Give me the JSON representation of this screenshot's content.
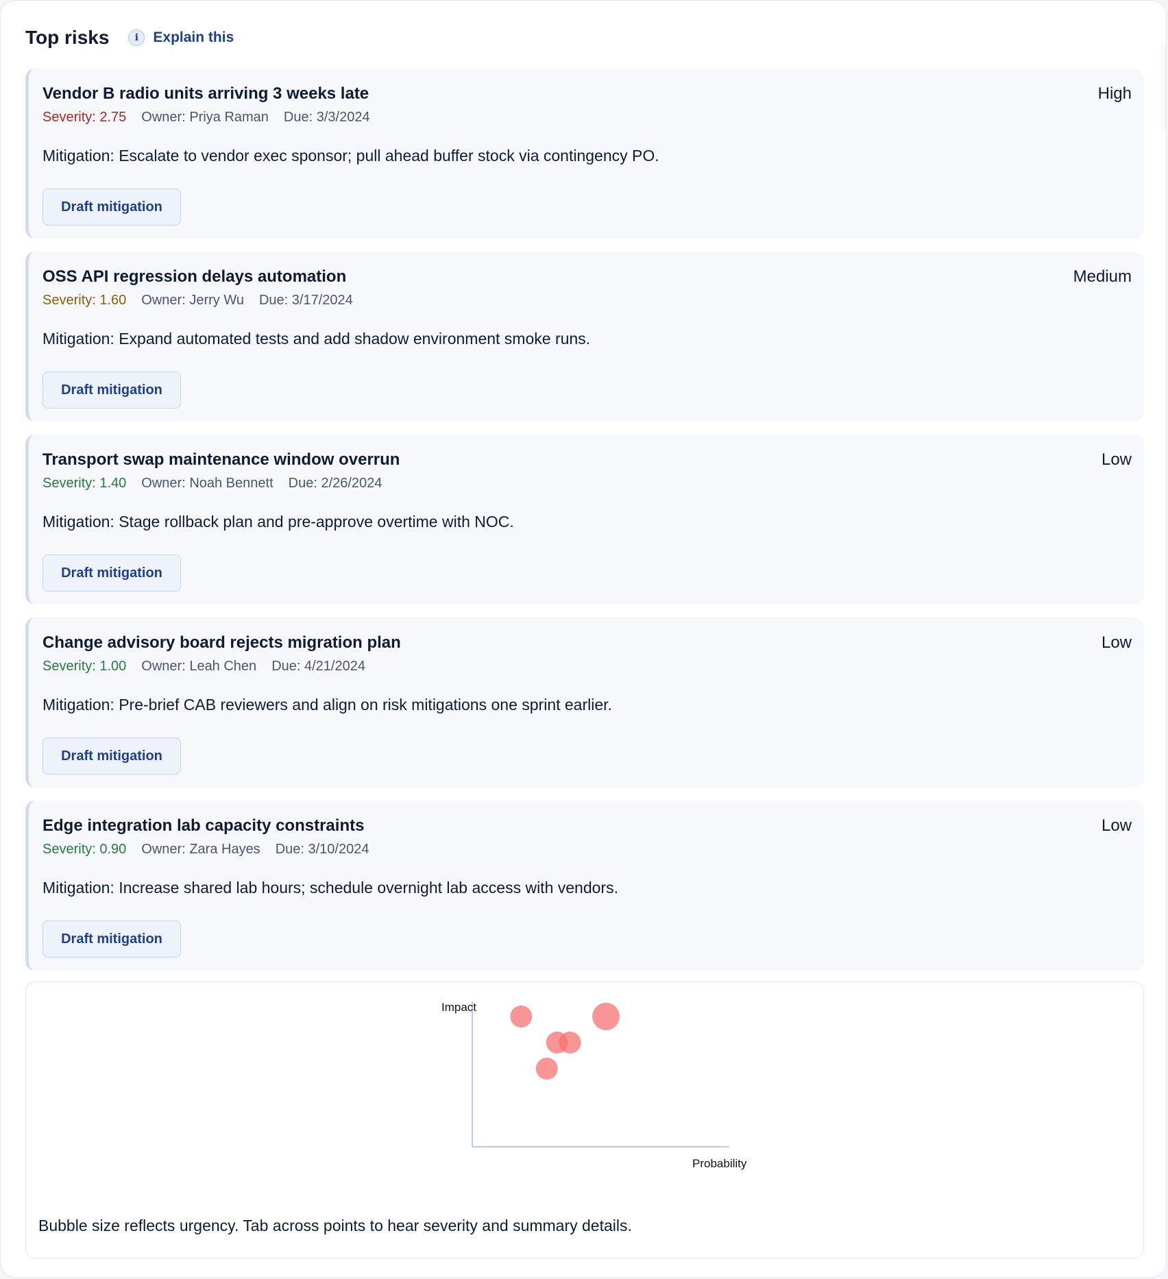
{
  "header": {
    "title": "Top risks",
    "explain_label": "Explain this",
    "info_icon": "info-icon"
  },
  "risks": [
    {
      "title": "Vendor B radio units arriving 3 weeks late",
      "level": "High",
      "severity": "Severity: 2.75",
      "severity_color": "#b3261e",
      "owner": "Owner: Priya Raman",
      "due": "Due: 3/3/2024",
      "mitigation": "Mitigation: Escalate to vendor exec sponsor; pull ahead buffer stock via contingency PO.",
      "button": "Draft mitigation"
    },
    {
      "title": "OSS API regression delays automation",
      "level": "Medium",
      "severity": "Severity: 1.60",
      "severity_color": "#8a6100",
      "owner": "Owner: Jerry Wu",
      "due": "Due: 3/17/2024",
      "mitigation": "Mitigation: Expand automated tests and add shadow environment smoke runs.",
      "button": "Draft mitigation"
    },
    {
      "title": "Transport swap maintenance window overrun",
      "level": "Low",
      "severity": "Severity: 1.40",
      "severity_color": "#257a3e",
      "owner": "Owner: Noah Bennett",
      "due": "Due: 2/26/2024",
      "mitigation": "Mitigation: Stage rollback plan and pre-approve overtime with NOC.",
      "button": "Draft mitigation"
    },
    {
      "title": "Change advisory board rejects migration plan",
      "level": "Low",
      "severity": "Severity: 1.00",
      "severity_color": "#257a3e",
      "owner": "Owner: Leah Chen",
      "due": "Due: 4/21/2024",
      "mitigation": "Mitigation: Pre-brief CAB reviewers and align on risk mitigations one sprint earlier.",
      "button": "Draft mitigation"
    },
    {
      "title": "Edge integration lab capacity constraints",
      "level": "Low",
      "severity": "Severity: 0.90",
      "severity_color": "#257a3e",
      "owner": "Owner: Zara Hayes",
      "due": "Due: 3/10/2024",
      "mitigation": "Mitigation: Increase shared lab hours; schedule overnight lab access with vendors.",
      "button": "Draft mitigation"
    }
  ],
  "chart_data": {
    "type": "scatter",
    "xlabel": "Probability",
    "ylabel": "Impact",
    "xlim": [
      0,
      1
    ],
    "ylim": [
      0,
      1
    ],
    "points": [
      {
        "x": 0.52,
        "y": 1.0,
        "size": 1.0
      },
      {
        "x": 0.19,
        "y": 1.0,
        "size": 0.6
      },
      {
        "x": 0.33,
        "y": 0.8,
        "size": 0.6
      },
      {
        "x": 0.38,
        "y": 0.8,
        "size": 0.6
      },
      {
        "x": 0.29,
        "y": 0.6,
        "size": 0.6
      }
    ],
    "bubble_color": "#f87171",
    "axis_color": "#a5b4ee"
  },
  "chart_note": "Bubble size reflects urgency. Tab across points to hear severity and summary details."
}
